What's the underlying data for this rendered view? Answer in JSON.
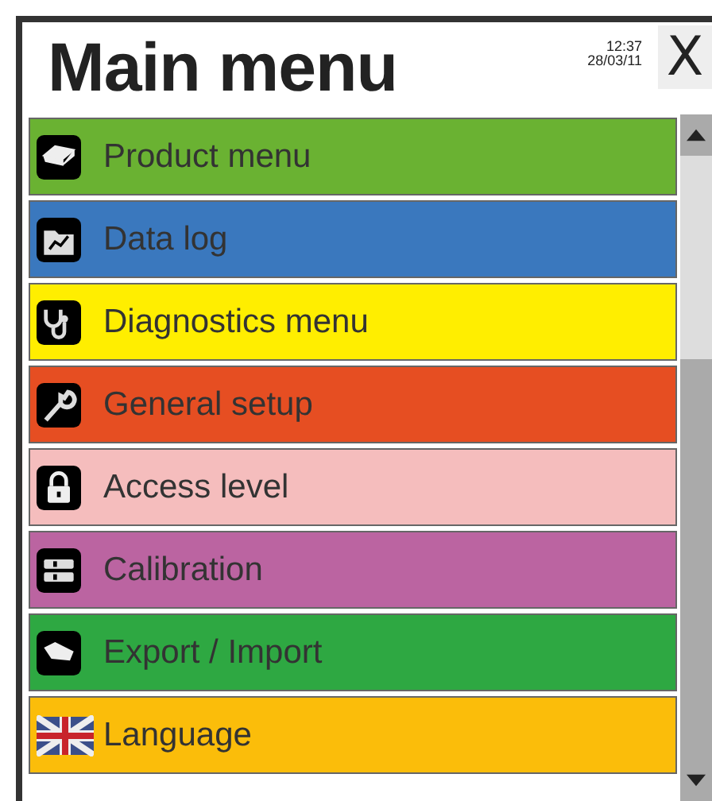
{
  "window": {
    "title": "Main menu",
    "time": "12:37",
    "date": "28/03/11",
    "close": "X"
  },
  "items": [
    {
      "label": "Product menu",
      "color": "#6ab232",
      "kind": "product"
    },
    {
      "label": "Data log",
      "color": "#3a78be",
      "kind": "datalog"
    },
    {
      "label": "Diagnostics menu",
      "color": "#ffee00",
      "kind": "diagnostics"
    },
    {
      "label": "General setup",
      "color": "#e64e22",
      "kind": "setup"
    },
    {
      "label": "Access level",
      "color": "#f5bdbd",
      "kind": "access"
    },
    {
      "label": "Calibration",
      "color": "#bb64a1",
      "kind": "calibration"
    },
    {
      "label": "Export / Import",
      "color": "#2ea842",
      "kind": "export"
    },
    {
      "label": "Language",
      "color": "#fbbd0a",
      "kind": "flag"
    }
  ]
}
